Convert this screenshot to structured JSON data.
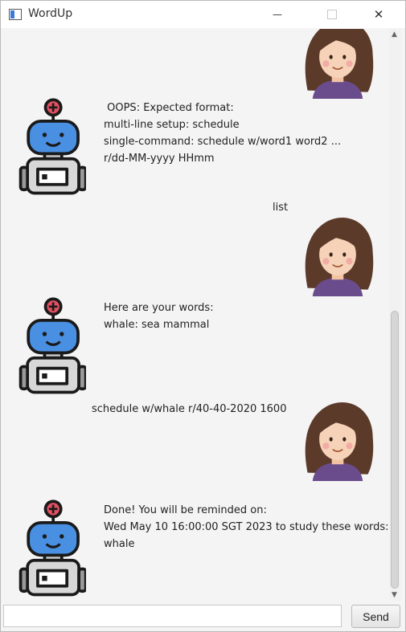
{
  "window": {
    "title": "WordUp",
    "minimize_symbol": "—",
    "close_symbol": "✕"
  },
  "messages": [
    {
      "sender": "user",
      "text": "",
      "avatar": "girl-avatar"
    },
    {
      "sender": "bot",
      "text": " OOPS: Expected format:\nmulti-line setup: schedule\nsingle-command: schedule w/word1 word2 ...\nr/dd-MM-yyyy HHmm",
      "avatar": "robot-avatar"
    },
    {
      "sender": "user",
      "text": "list",
      "avatar": "girl-avatar"
    },
    {
      "sender": "bot",
      "text": "Here are your words:\nwhale: sea mammal",
      "avatar": "robot-avatar"
    },
    {
      "sender": "user",
      "text": "schedule w/whale r/40-40-2020 1600",
      "avatar": "girl-avatar"
    },
    {
      "sender": "bot",
      "text": "Done! You will be reminded on:\nWed May 10 16:00:00 SGT 2023 to study these words:\nwhale",
      "avatar": "robot-avatar"
    }
  ],
  "input": {
    "value": "",
    "placeholder": "",
    "send_label": "Send"
  },
  "colors": {
    "robot_body": "#4a90e2",
    "robot_light": "#e05061",
    "girl_hair": "#5b3a29",
    "girl_shirt": "#6a4c8c",
    "background": "#f4f4f4"
  }
}
